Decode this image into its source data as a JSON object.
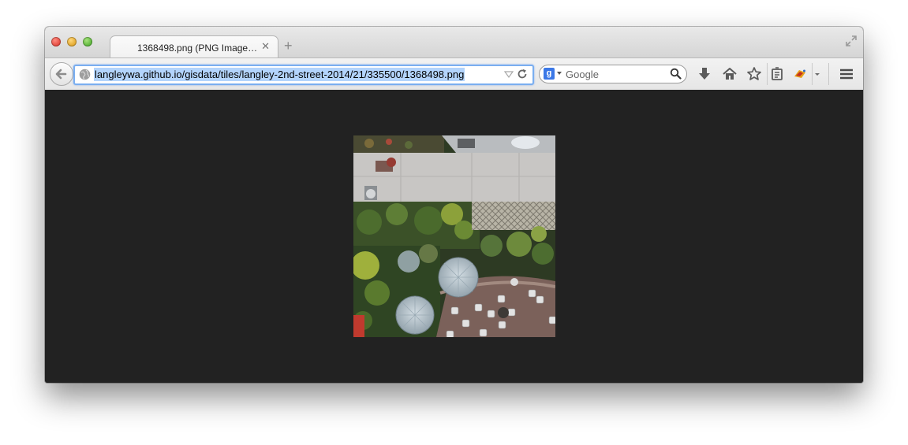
{
  "tab": {
    "title": "1368498.png (PNG Image…",
    "close_glyph": "✕",
    "new_tab_glyph": "+"
  },
  "navbar": {
    "url": "langleywa.github.io/gisdata/tiles/langley-2nd-street-2014/21/335500/1368498.png",
    "search_placeholder": "Google",
    "search_engine_letter": "g"
  },
  "icons": {
    "window_controls": [
      "close-icon",
      "minimize-icon",
      "zoom-icon"
    ],
    "toolbar": [
      "back-arrow-icon",
      "globe-icon",
      "url-dropdown-icon",
      "reload-icon",
      "search-icon",
      "download-icon",
      "home-icon",
      "bookmark-star-icon",
      "reading-list-icon",
      "addon-icon",
      "menu-icon",
      "fullscreen-icon"
    ]
  },
  "colors": {
    "content_background": "#222222",
    "url_selection": "#b3d4fc",
    "focus_ring": "#7aaef0"
  }
}
